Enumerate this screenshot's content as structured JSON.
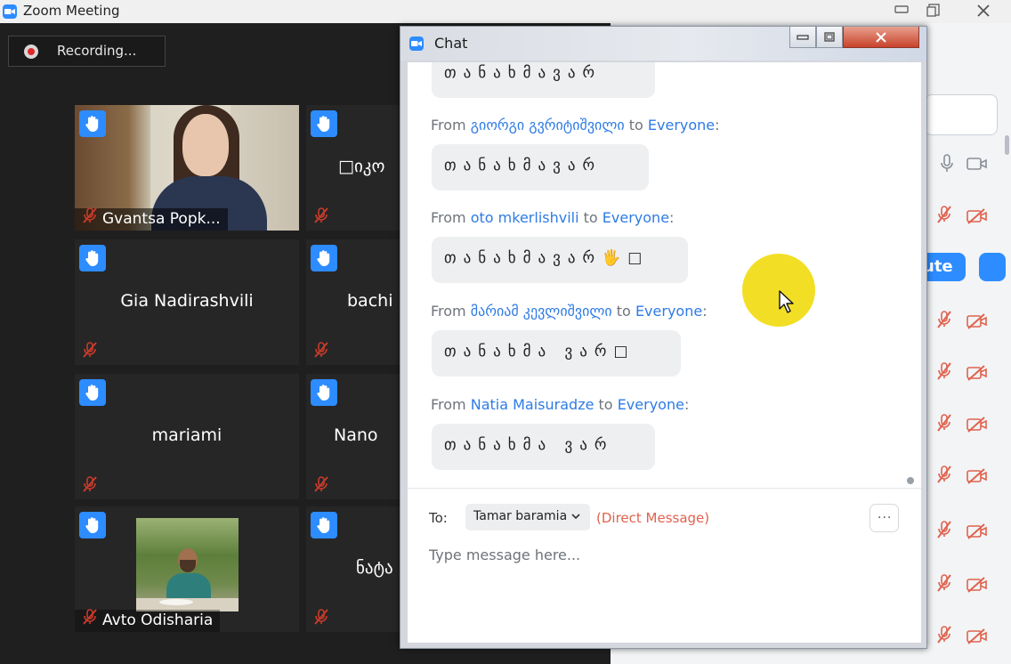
{
  "window": {
    "title": "Zoom Meeting"
  },
  "recording": {
    "label": "Recording..."
  },
  "tiles": [
    {
      "name": "Gvantsa Popk...",
      "has_video": true,
      "muted": true,
      "hand_raised": true
    },
    {
      "name": "Gia Nadirashvili",
      "muted": true,
      "hand_raised": true
    },
    {
      "name": "mariami",
      "muted": true,
      "hand_raised": true
    },
    {
      "name": "Avto Odisharia",
      "has_video": true,
      "muted": true,
      "hand_raised": true
    },
    {
      "name": "□იკო",
      "muted": true,
      "hand_raised": true
    },
    {
      "name": "bachi",
      "muted": true,
      "hand_raised": true
    },
    {
      "name": "Nano",
      "muted": true,
      "hand_raised": true
    },
    {
      "name": "ნატა",
      "muted": true,
      "hand_raised": true
    }
  ],
  "participants_panel": {
    "mute_all_label": "ute"
  },
  "chat": {
    "title": "Chat",
    "messages": [
      {
        "text": "თანახმავარ"
      },
      {
        "from_label": "From",
        "sender": "გიორგი გვრიტიშვილი",
        "to_label": "to",
        "recipient": "Everyone",
        "colon": ":",
        "text": "თანახმავარ"
      },
      {
        "from_label": "From",
        "sender": "oto mkerlishvili",
        "to_label": "to",
        "recipient": "Everyone",
        "colon": ":",
        "text": "თანახმავარ🖐□"
      },
      {
        "from_label": "From",
        "sender": "მარიამ კევლიშვილი",
        "to_label": "to",
        "recipient": "Everyone",
        "colon": ":",
        "text": "თანახმა ვარ□"
      },
      {
        "from_label": "From",
        "sender": "Natia Maisuradze",
        "to_label": "to",
        "recipient": "Everyone",
        "colon": ":",
        "text": "თანახმა ვარ"
      }
    ],
    "to_label": "To:",
    "recipient_select": "Tamar baramia",
    "direct_message": "(Direct Message)",
    "more_label": "···",
    "input_placeholder": "Type message here..."
  },
  "icons": {
    "hand": "raised-hand-icon",
    "mic_off": "mic-off-icon",
    "cam_off": "video-off-icon",
    "mic": "microphone-icon",
    "cam": "video-camera-icon",
    "record": "record-dot-icon",
    "dropdown": "chevron-down-icon",
    "cursor": "mouse-cursor-icon"
  },
  "colors": {
    "zoom_blue": "#2d8cff",
    "link_blue": "#2e7be5",
    "muted_red": "#e0624e",
    "dark_bg": "#1f1f1f",
    "tile_bg": "#262626",
    "cursor_highlight": "#f1dd14"
  }
}
